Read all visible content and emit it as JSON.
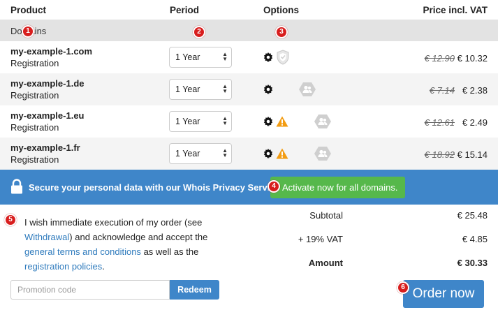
{
  "header": {
    "product": "Product",
    "period": "Period",
    "options": "Options",
    "price": "Price incl. VAT"
  },
  "section_label": "Domains",
  "rows": [
    {
      "domain": "my-example-1.com",
      "type": "Registration",
      "period": "1 Year",
      "old_price": "€ 12.90",
      "price": "€ 10.32",
      "options": [
        "gear-icon",
        "shield-icon"
      ]
    },
    {
      "domain": "my-example-1.de",
      "type": "Registration",
      "period": "1 Year",
      "old_price": "€ 7.14",
      "price": "€ 2.38",
      "options": [
        "gear-icon",
        "contacts-hex-icon"
      ]
    },
    {
      "domain": "my-example-1.eu",
      "type": "Registration",
      "period": "1 Year",
      "old_price": "€ 12.61",
      "price": "€ 2.49",
      "options": [
        "gear-icon",
        "warning-icon",
        "contacts-hex-icon"
      ]
    },
    {
      "domain": "my-example-1.fr",
      "type": "Registration",
      "period": "1 Year",
      "old_price": "€ 18.92",
      "price": "€ 15.14",
      "options": [
        "gear-icon",
        "warning-icon",
        "contacts-hex-icon"
      ]
    }
  ],
  "privacy": {
    "text": "Secure your personal data with our Whois Privacy Service.",
    "button": "Activate now for all domains."
  },
  "badges": [
    "1",
    "2",
    "3",
    "4",
    "5",
    "6"
  ],
  "legal": {
    "before_withdrawal": "I wish immediate execution of my order (see",
    "withdrawal_link": "Withdrawal",
    "middle": ") and acknowledge and accept the",
    "terms_link": "general terms and conditions",
    "as_well": "as well as the",
    "policies_link": "registration policies",
    "end": "."
  },
  "totals": {
    "subtotal_label": "Subtotal",
    "subtotal": "€ 25.48",
    "vat_label": "+ 19% VAT",
    "vat": "€ 4.85",
    "amount_label": "Amount",
    "amount": "€ 30.33"
  },
  "promo": {
    "placeholder": "Promotion code",
    "button": "Redeem"
  },
  "order_button": "Order now",
  "colors": {
    "accent_blue": "#3f86c9",
    "activate_green": "#56b84b",
    "badge_red": "#d81e1e",
    "link_blue": "#2f7bbd"
  }
}
